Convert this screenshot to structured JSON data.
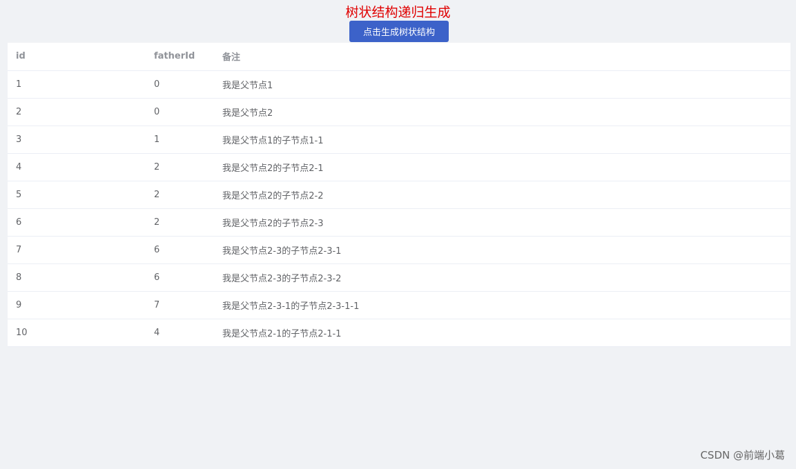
{
  "header": {
    "title": "树状结构递归生成",
    "button_label": "点击生成树状结构"
  },
  "table": {
    "columns": [
      "id",
      "fatherId",
      "备注"
    ],
    "rows": [
      {
        "id": "1",
        "fatherId": "0",
        "note": "我是父节点1"
      },
      {
        "id": "2",
        "fatherId": "0",
        "note": "我是父节点2"
      },
      {
        "id": "3",
        "fatherId": "1",
        "note": "我是父节点1的子节点1-1"
      },
      {
        "id": "4",
        "fatherId": "2",
        "note": "我是父节点2的子节点2-1"
      },
      {
        "id": "5",
        "fatherId": "2",
        "note": "我是父节点2的子节点2-2"
      },
      {
        "id": "6",
        "fatherId": "2",
        "note": "我是父节点2的子节点2-3"
      },
      {
        "id": "7",
        "fatherId": "6",
        "note": "我是父节点2-3的子节点2-3-1"
      },
      {
        "id": "8",
        "fatherId": "6",
        "note": "我是父节点2-3的子节点2-3-2"
      },
      {
        "id": "9",
        "fatherId": "7",
        "note": "我是父节点2-3-1的子节点2-3-1-1"
      },
      {
        "id": "10",
        "fatherId": "4",
        "note": "我是父节点2-1的子节点2-1-1"
      }
    ]
  },
  "watermark": "CSDN @前端小葛",
  "colors": {
    "title": "#e00000",
    "button": "#3c62c9",
    "background": "#f0f2f5"
  }
}
